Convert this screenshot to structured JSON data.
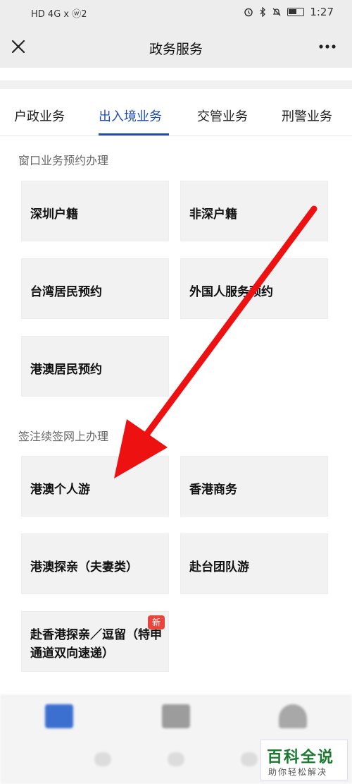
{
  "status_bar": {
    "left_text": "HD 4G 𝗑 ⓦ2",
    "time": "1:27"
  },
  "nav": {
    "title": "政务服务",
    "close_icon": "close-icon",
    "more_icon": "more-icon"
  },
  "tabs": [
    {
      "label": "户政业务"
    },
    {
      "label": "出入境业务",
      "active": true
    },
    {
      "label": "交管业务"
    },
    {
      "label": "刑警业务"
    }
  ],
  "sections": [
    {
      "title": "窗口业务预约办理",
      "cards": [
        {
          "label": "深圳户籍"
        },
        {
          "label": "非深户籍"
        },
        {
          "label": "台湾居民预约"
        },
        {
          "label": "外国人服务预约"
        },
        {
          "label": "港澳居民预约"
        }
      ]
    },
    {
      "title": "签注续签网上办理",
      "cards": [
        {
          "label": "港澳个人游"
        },
        {
          "label": "香港商务"
        },
        {
          "label": "港澳探亲（夫妻类）"
        },
        {
          "label": "赴台团队游"
        },
        {
          "label": "赴香港探亲／逗留（特申通道双向速递）",
          "badge": "新"
        }
      ]
    }
  ],
  "watermark": {
    "title": "百科全说",
    "subtitle": "助你轻松解决"
  },
  "colors": {
    "accent": "#1f4fa8",
    "arrow": "#ee1111",
    "badge": "#e8453c",
    "card_bg": "#f2f2f2"
  }
}
